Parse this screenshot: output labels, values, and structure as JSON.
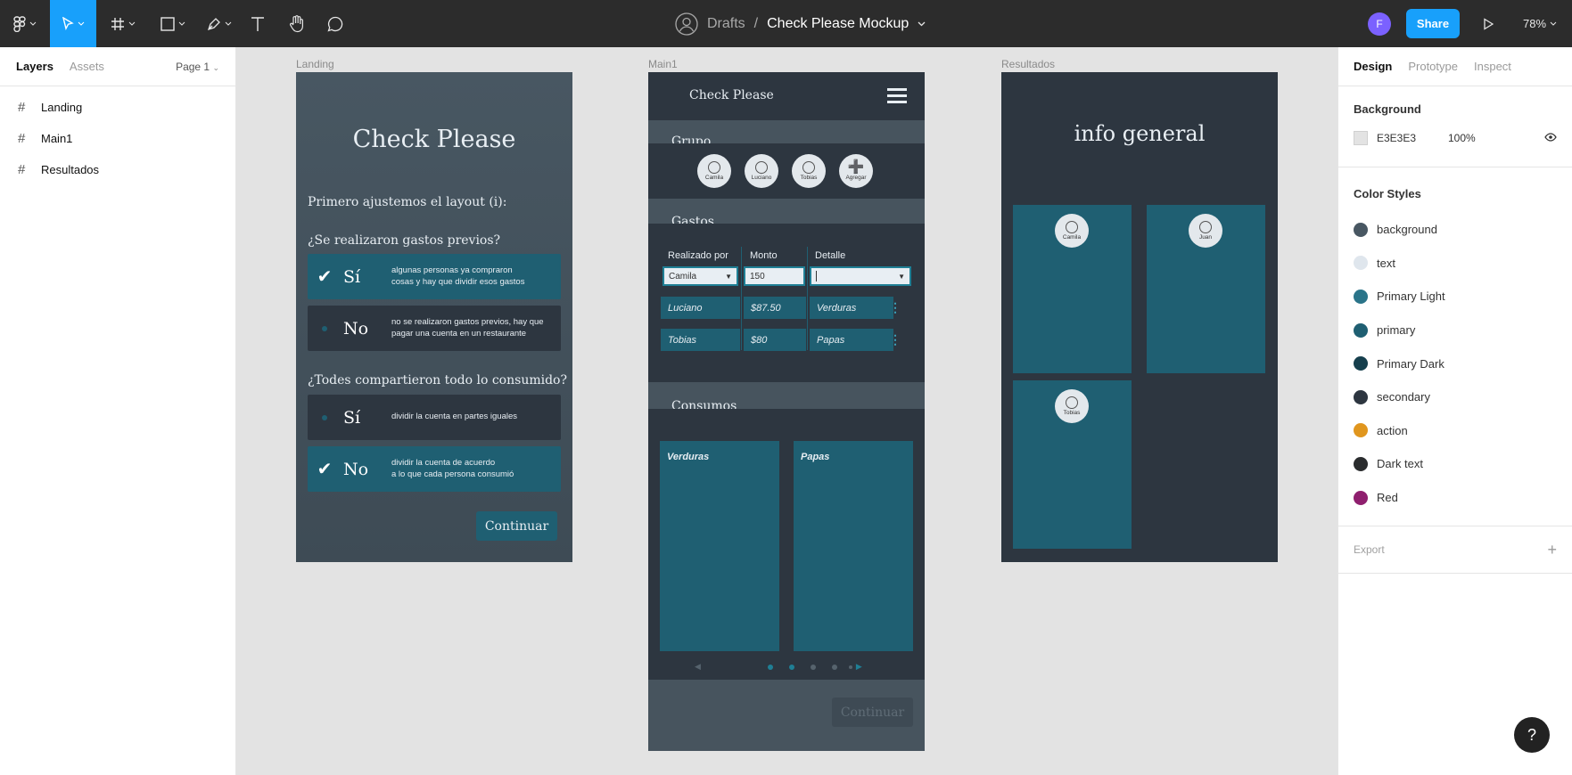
{
  "toolbar": {
    "breadcrumb_folder": "Drafts",
    "breadcrumb_sep": "/",
    "file_name": "Check Please Mockup",
    "avatar_initial": "F",
    "share_label": "Share",
    "zoom": "78%"
  },
  "left_panel": {
    "tabs": [
      "Layers",
      "Assets"
    ],
    "page": "Page 1",
    "layers": [
      "Landing",
      "Main1",
      "Resultados"
    ]
  },
  "right_panel": {
    "tabs": [
      "Design",
      "Prototype",
      "Inspect"
    ],
    "background_title": "Background",
    "background_hex": "E3E3E3",
    "background_opacity": "100%",
    "color_styles_title": "Color Styles",
    "color_styles": [
      {
        "name": "background",
        "color": "#485762"
      },
      {
        "name": "text",
        "color": "#dfe6ed"
      },
      {
        "name": "Primary Light",
        "color": "#2a7489"
      },
      {
        "name": "primary",
        "color": "#1f5f72"
      },
      {
        "name": "Primary Dark",
        "color": "#163f4d"
      },
      {
        "name": "secondary",
        "color": "#2d3640"
      },
      {
        "name": "action",
        "color": "#e0961e"
      },
      {
        "name": "Dark text",
        "color": "#2a2c2e"
      },
      {
        "name": "Red",
        "color": "#8f1f6e"
      }
    ],
    "export_label": "Export"
  },
  "frames": {
    "landing_label": "Landing",
    "main_label": "Main1",
    "results_label": "Resultados"
  },
  "landing": {
    "title": "Check Please",
    "intro": "Primero ajustemos el layout (i):",
    "q1": "¿Se realizaron gastos previos?",
    "q1_yes": "Sí",
    "q1_yes_desc1": "algunas personas ya compraron",
    "q1_yes_desc2": "cosas y hay que dividir esos gastos",
    "q1_no": "No",
    "q1_no_desc1": "no se realizaron gastos previos, hay que",
    "q1_no_desc2": "pagar una cuenta en un restaurante",
    "q2": "¿Todes compartieron todo lo consumido?",
    "q2_yes": "Sí",
    "q2_yes_desc": "dividir la cuenta en partes iguales",
    "q2_no": "No",
    "q2_no_desc1": "dividir la cuenta de acuerdo",
    "q2_no_desc2": "a lo que cada persona consumió",
    "continue": "Continuar"
  },
  "main": {
    "title": "Check Please",
    "grupo": "Grupo",
    "members": [
      "Camila",
      "Luciano",
      "Tobias",
      "Agregar"
    ],
    "gastos": "Gastos",
    "headers": [
      "Realizado por",
      "Monto",
      "Detalle"
    ],
    "input_person": "Camila",
    "input_amount": "150",
    "rows": [
      {
        "person": "Luciano",
        "amount": "$87.50",
        "detail": "Verduras"
      },
      {
        "person": "Tobias",
        "amount": "$80",
        "detail": "Papas"
      }
    ],
    "consumos": "Consumos",
    "cards": [
      "Verduras",
      "Papas"
    ],
    "continue": "Continuar"
  },
  "results": {
    "title": "info general",
    "people": [
      "Camila",
      "Juan",
      "Tobias"
    ]
  }
}
